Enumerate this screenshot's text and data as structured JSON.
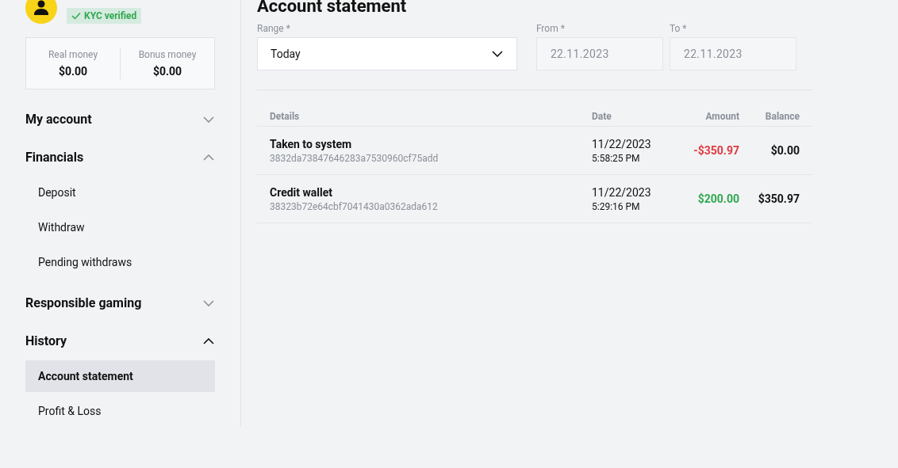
{
  "profile": {
    "kyc": {
      "label": "KYC verified",
      "verified": true
    }
  },
  "balances": [
    {
      "label": "Real money",
      "value": "$0.00"
    },
    {
      "label": "Bonus money",
      "value": "$0.00"
    }
  ],
  "menu": [
    {
      "label": "My account",
      "expanded": false
    },
    {
      "label": "Financials",
      "expanded": true,
      "children": [
        {
          "label": "Deposit",
          "selected": false
        },
        {
          "label": "Withdraw",
          "selected": false
        },
        {
          "label": "Pending withdraws",
          "selected": false
        }
      ]
    },
    {
      "label": "Responsible gaming",
      "expanded": false
    },
    {
      "label": "History",
      "expanded": true,
      "children": [
        {
          "label": "Account statement",
          "selected": true
        },
        {
          "label": "Profit & Loss",
          "selected": false
        }
      ]
    }
  ],
  "page_title": "Account statement",
  "filters": {
    "range": {
      "label": "Range *",
      "value": "Today"
    },
    "from": {
      "label": "From *",
      "value": "22.11.2023",
      "disabled": true
    },
    "to": {
      "label": "To *",
      "value": "22.11.2023",
      "disabled": true
    }
  },
  "table": {
    "columns": [
      "Details",
      "Date",
      "Amount",
      "Balance"
    ],
    "rows": [
      {
        "title": "Taken to system",
        "id": "3832da73847646283a7530960cf75add",
        "date": "11/22/2023",
        "time": "5:58:25 PM",
        "amount": "-$350.97",
        "color": "#e0393e",
        "balance": "$0.00"
      },
      {
        "title": "Credit wallet",
        "id": "38323b72e64cbf7041430a0362ada612",
        "date": "11/22/2023",
        "time": "5:29:16 PM",
        "amount": "$200.00",
        "color": "#2fa84f",
        "balance": "$350.97"
      }
    ]
  }
}
